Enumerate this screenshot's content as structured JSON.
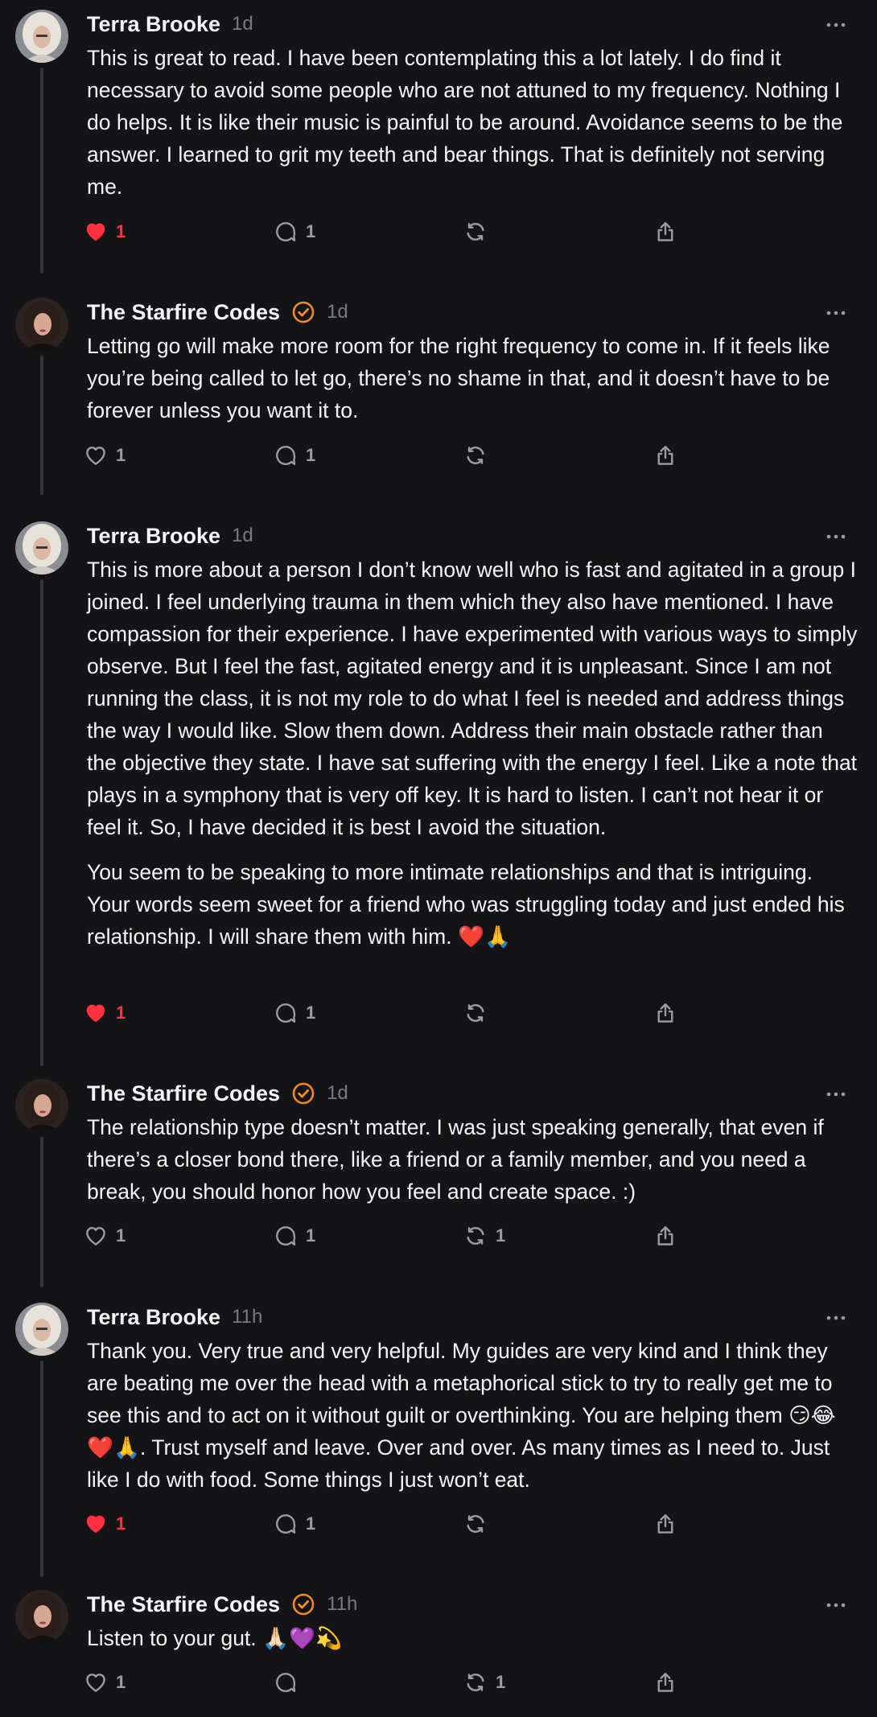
{
  "colors": {
    "background": "#141416",
    "text": "#f3f5f7",
    "muted": "#777b80",
    "like": "#ff3040",
    "verified": "#f08a24"
  },
  "posts": [
    {
      "author": "Terra Brooke",
      "avatar": "terra-brooke-avatar",
      "verified": false,
      "time": "1d",
      "paragraphs": [
        "This is great to read. I have been contemplating this a lot lately. I do find it necessary to avoid some people who are not attuned to my frequency. Nothing I do helps. It is like their music is painful to be around. Avoidance seems to be the answer. I learned to grit my teeth and bear things. That is definitely not serving me."
      ],
      "liked": true,
      "likes": "1",
      "replies": "1",
      "reposts": ""
    },
    {
      "author": "The Starfire Codes",
      "avatar": "starfire-codes-avatar",
      "verified": true,
      "time": "1d",
      "paragraphs": [
        "Letting go will make more room for the right frequency to come in. If it feels like you’re being called to let go, there’s no shame in that, and it doesn’t have to be forever unless you want it to."
      ],
      "liked": false,
      "likes": "1",
      "replies": "1",
      "reposts": ""
    },
    {
      "author": "Terra Brooke",
      "avatar": "terra-brooke-avatar",
      "verified": false,
      "time": "1d",
      "paragraphs": [
        "This is more about a person I don’t know well who is fast and agitated in a group I joined. I feel underlying trauma in them which they also have mentioned. I have compassion for their experience. I have experimented with various ways to simply observe. But I feel the fast, agitated energy and it is unpleasant. Since I am not running the class, it is not my role to do what I feel is needed and address things the way I would like. Slow them down. Address their main obstacle rather than the objective they state. I have sat suffering with the energy I feel. Like a note that plays in a symphony that is very off key. It is hard to listen. I can’t not hear it or feel it. So, I have decided it is best I avoid the situation.",
        "You seem to be speaking to more intimate relationships and that is intriguing. Your words seem sweet for a friend who was struggling today and just ended his relationship. I will share them with him. ❤️🙏"
      ],
      "liked": true,
      "likes": "1",
      "replies": "1",
      "reposts": ""
    },
    {
      "author": "The Starfire Codes",
      "avatar": "starfire-codes-avatar",
      "verified": true,
      "time": "1d",
      "paragraphs": [
        "The relationship type doesn’t matter. I was just speaking generally, that even if there’s a closer bond there, like a friend or a family member, and you need a break, you should honor how you feel and create space. :)"
      ],
      "liked": false,
      "likes": "1",
      "replies": "1",
      "reposts": "1"
    },
    {
      "author": "Terra Brooke",
      "avatar": "terra-brooke-avatar",
      "verified": false,
      "time": "11h",
      "paragraphs": [
        "Thank you. Very true and very helpful. My guides are very kind and I think they are beating me over the head with a metaphorical stick to try to really get me to see this and to act on it without guilt or overthinking. You are helping them 😏😂❤️🙏. Trust myself and leave. Over and over. As many times as I need to. Just like I do with food. Some things I just won’t eat."
      ],
      "liked": true,
      "likes": "1",
      "replies": "1",
      "reposts": ""
    },
    {
      "author": "The Starfire Codes",
      "avatar": "starfire-codes-avatar",
      "verified": true,
      "time": "11h",
      "paragraphs": [
        "Listen to your gut. 🙏🏻💜💫"
      ],
      "liked": false,
      "likes": "1",
      "replies": "",
      "reposts": "1"
    }
  ]
}
